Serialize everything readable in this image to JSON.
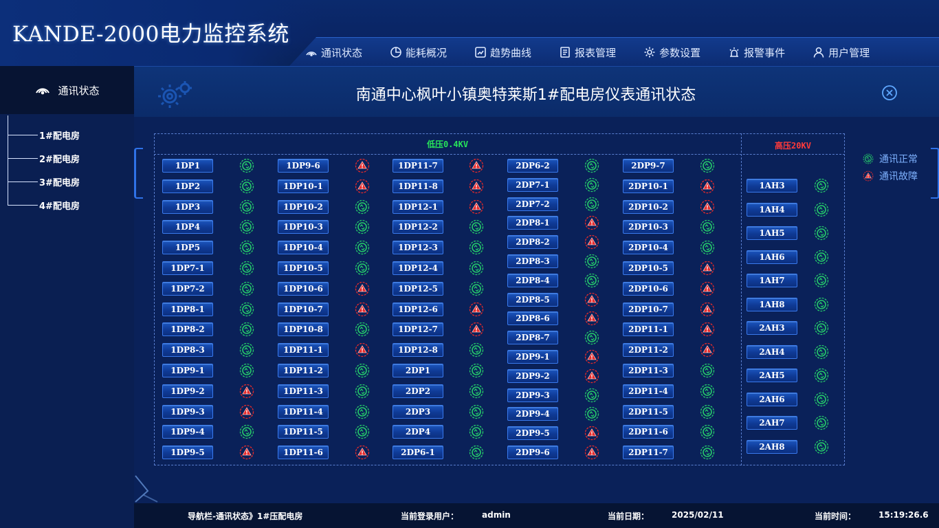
{
  "app_title": "KANDE-2000电力监控系统",
  "nav": [
    {
      "label": "通讯状态",
      "icon": "signal-icon"
    },
    {
      "label": "能耗概况",
      "icon": "pie-chart-icon"
    },
    {
      "label": "趋势曲线",
      "icon": "trend-chart-icon"
    },
    {
      "label": "报表管理",
      "icon": "report-icon"
    },
    {
      "label": "参数设置",
      "icon": "gear-icon"
    },
    {
      "label": "报警事件",
      "icon": "alarm-icon"
    },
    {
      "label": "用户管理",
      "icon": "user-icon"
    }
  ],
  "sidebar": {
    "title": "通讯状态",
    "items": [
      "1#配电房",
      "2#配电房",
      "3#配电房",
      "4#配电房"
    ]
  },
  "main": {
    "title": "南通中心枫叶小镇奥特莱斯1#配电房仪表通讯状态"
  },
  "sections": {
    "low": "低压0.4KV",
    "high": "高压20KV"
  },
  "legend": {
    "ok": "通讯正常",
    "fault": "通讯故障"
  },
  "colors": {
    "ok": "#25c96a",
    "fault": "#e52a2a",
    "low_label": "#27e45a",
    "high_label": "#ff3a3a"
  },
  "meters": {
    "col1": [
      {
        "name": "1DP1",
        "status": "ok"
      },
      {
        "name": "1DP2",
        "status": "ok"
      },
      {
        "name": "1DP3",
        "status": "ok"
      },
      {
        "name": "1DP4",
        "status": "ok"
      },
      {
        "name": "1DP5",
        "status": "ok"
      },
      {
        "name": "1DP7-1",
        "status": "ok"
      },
      {
        "name": "1DP7-2",
        "status": "ok"
      },
      {
        "name": "1DP8-1",
        "status": "ok"
      },
      {
        "name": "1DP8-2",
        "status": "ok"
      },
      {
        "name": "1DP8-3",
        "status": "ok"
      },
      {
        "name": "1DP9-1",
        "status": "ok"
      },
      {
        "name": "1DP9-2",
        "status": "fault"
      },
      {
        "name": "1DP9-3",
        "status": "fault"
      },
      {
        "name": "1DP9-4",
        "status": "ok"
      },
      {
        "name": "1DP9-5",
        "status": "fault"
      }
    ],
    "col2": [
      {
        "name": "1DP9-6",
        "status": "fault"
      },
      {
        "name": "1DP10-1",
        "status": "fault"
      },
      {
        "name": "1DP10-2",
        "status": "ok"
      },
      {
        "name": "1DP10-3",
        "status": "ok"
      },
      {
        "name": "1DP10-4",
        "status": "ok"
      },
      {
        "name": "1DP10-5",
        "status": "ok"
      },
      {
        "name": "1DP10-6",
        "status": "fault"
      },
      {
        "name": "1DP10-7",
        "status": "fault"
      },
      {
        "name": "1DP10-8",
        "status": "ok"
      },
      {
        "name": "1DP11-1",
        "status": "fault"
      },
      {
        "name": "1DP11-2",
        "status": "ok"
      },
      {
        "name": "1DP11-3",
        "status": "ok"
      },
      {
        "name": "1DP11-4",
        "status": "ok"
      },
      {
        "name": "1DP11-5",
        "status": "ok"
      },
      {
        "name": "1DP11-6",
        "status": "fault"
      }
    ],
    "col3": [
      {
        "name": "1DP11-7",
        "status": "fault"
      },
      {
        "name": "1DP11-8",
        "status": "fault"
      },
      {
        "name": "1DP12-1",
        "status": "fault"
      },
      {
        "name": "1DP12-2",
        "status": "ok"
      },
      {
        "name": "1DP12-3",
        "status": "ok"
      },
      {
        "name": "1DP12-4",
        "status": "ok"
      },
      {
        "name": "1DP12-5",
        "status": "ok"
      },
      {
        "name": "1DP12-6",
        "status": "fault"
      },
      {
        "name": "1DP12-7",
        "status": "fault"
      },
      {
        "name": "1DP12-8",
        "status": "ok"
      },
      {
        "name": "2DP1",
        "status": "ok"
      },
      {
        "name": "2DP2",
        "status": "ok"
      },
      {
        "name": "2DP3",
        "status": "ok"
      },
      {
        "name": "2DP4",
        "status": "ok"
      },
      {
        "name": "2DP6-1",
        "status": "ok"
      }
    ],
    "col4": [
      {
        "name": "2DP6-2",
        "status": "ok"
      },
      {
        "name": "2DP7-1",
        "status": "ok"
      },
      {
        "name": "2DP7-2",
        "status": "ok"
      },
      {
        "name": "2DP8-1",
        "status": "fault"
      },
      {
        "name": "2DP8-2",
        "status": "fault"
      },
      {
        "name": "2DP8-3",
        "status": "ok"
      },
      {
        "name": "2DP8-4",
        "status": "ok"
      },
      {
        "name": "2DP8-5",
        "status": "fault"
      },
      {
        "name": "2DP8-6",
        "status": "fault"
      },
      {
        "name": "2DP8-7",
        "status": "ok"
      },
      {
        "name": "2DP9-1",
        "status": "fault"
      },
      {
        "name": "2DP9-2",
        "status": "fault"
      },
      {
        "name": "2DP9-3",
        "status": "ok"
      },
      {
        "name": "2DP9-4",
        "status": "ok"
      },
      {
        "name": "2DP9-5",
        "status": "fault"
      },
      {
        "name": "2DP9-6",
        "status": "fault"
      }
    ],
    "col5": [
      {
        "name": "2DP9-7",
        "status": "ok"
      },
      {
        "name": "2DP10-1",
        "status": "fault"
      },
      {
        "name": "2DP10-2",
        "status": "fault"
      },
      {
        "name": "2DP10-3",
        "status": "ok"
      },
      {
        "name": "2DP10-4",
        "status": "ok"
      },
      {
        "name": "2DP10-5",
        "status": "fault"
      },
      {
        "name": "2DP10-6",
        "status": "fault"
      },
      {
        "name": "2DP10-7",
        "status": "fault"
      },
      {
        "name": "2DP11-1",
        "status": "fault"
      },
      {
        "name": "2DP11-2",
        "status": "fault"
      },
      {
        "name": "2DP11-3",
        "status": "ok"
      },
      {
        "name": "2DP11-4",
        "status": "ok"
      },
      {
        "name": "2DP11-5",
        "status": "ok"
      },
      {
        "name": "2DP11-6",
        "status": "ok"
      },
      {
        "name": "2DP11-7",
        "status": "ok"
      }
    ],
    "high": [
      {
        "name": "1AH3",
        "status": "ok"
      },
      {
        "name": "1AH4",
        "status": "ok"
      },
      {
        "name": "1AH5",
        "status": "ok"
      },
      {
        "name": "1AH6",
        "status": "ok"
      },
      {
        "name": "1AH7",
        "status": "ok"
      },
      {
        "name": "1AH8",
        "status": "ok"
      },
      {
        "name": "2AH3",
        "status": "ok"
      },
      {
        "name": "2AH4",
        "status": "ok"
      },
      {
        "name": "2AH5",
        "status": "ok"
      },
      {
        "name": "2AH6",
        "status": "ok"
      },
      {
        "name": "2AH7",
        "status": "ok"
      },
      {
        "name": "2AH8",
        "status": "ok"
      }
    ]
  },
  "footer": {
    "breadcrumb": "导航栏-通讯状态》1#压配电房",
    "user_label": "当前登录用户：",
    "user": "admin",
    "date_label": "当前日期：",
    "date": "2025/02/11",
    "time_label": "当前时间：",
    "time": "15:19:26.6"
  }
}
